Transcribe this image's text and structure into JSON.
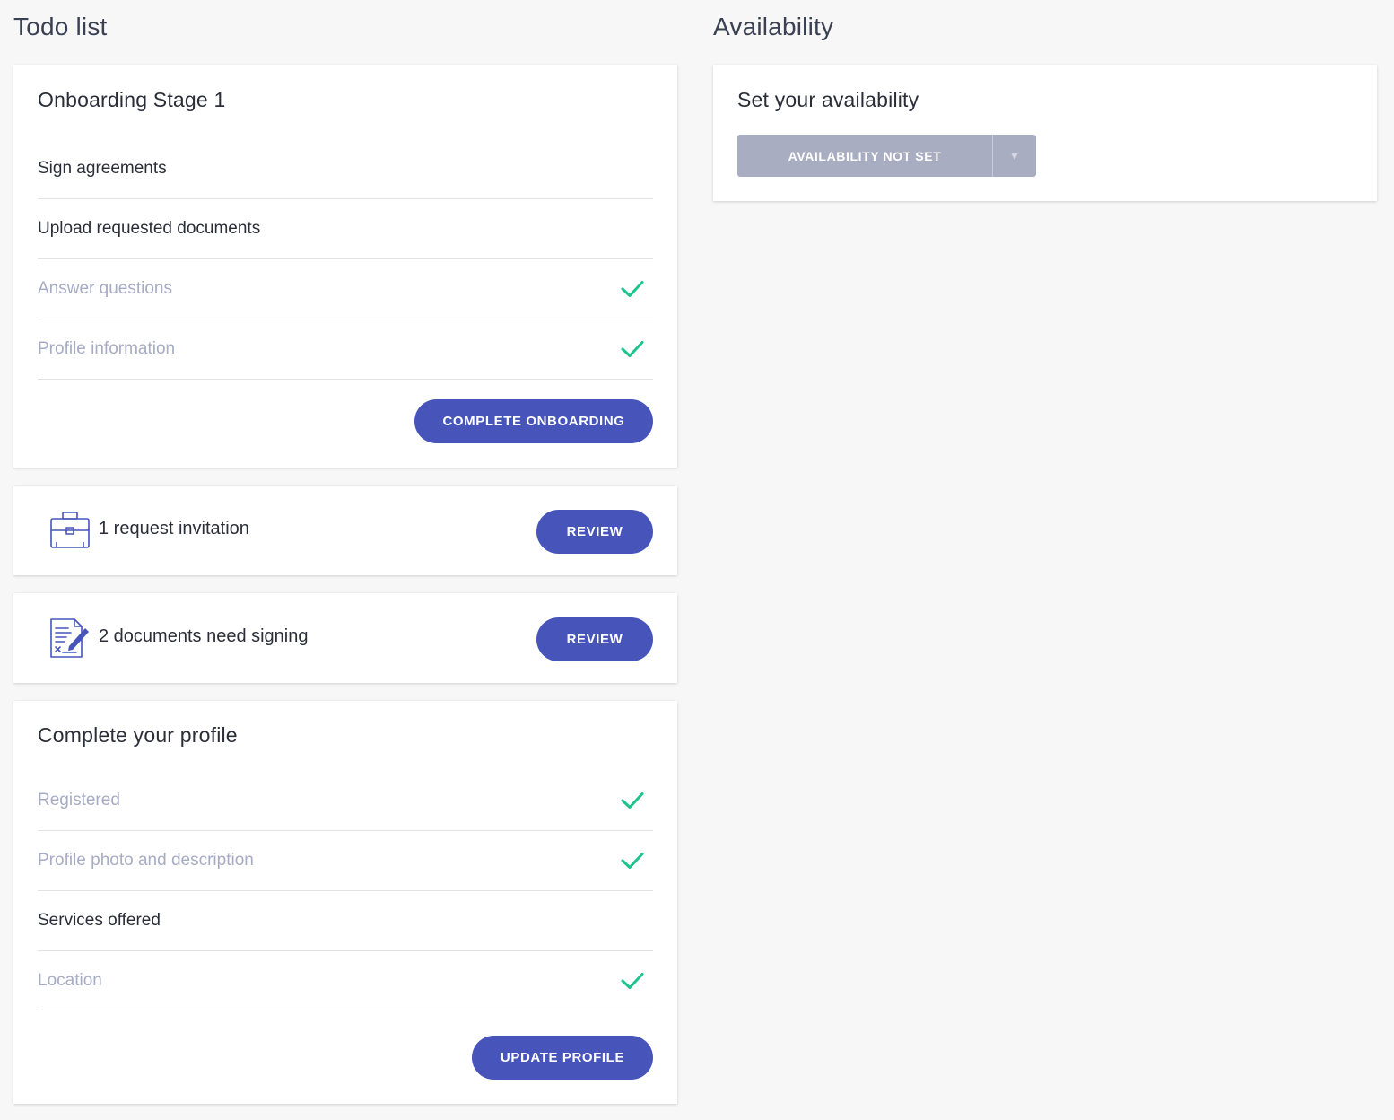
{
  "todo": {
    "title": "Todo list",
    "onboarding": {
      "title": "Onboarding Stage 1",
      "items": [
        {
          "label": "Sign agreements",
          "done": false
        },
        {
          "label": "Upload requested documents",
          "done": false
        },
        {
          "label": "Answer questions",
          "done": true
        },
        {
          "label": "Profile information",
          "done": true
        }
      ],
      "button_label": "COMPLETE ONBOARDING"
    },
    "invitation": {
      "text": "1 request invitation",
      "icon": "briefcase-icon",
      "button_label": "REVIEW"
    },
    "documents": {
      "text": "2 documents need signing",
      "icon": "document-sign-icon",
      "button_label": "REVIEW"
    },
    "profile": {
      "title": "Complete your profile",
      "items": [
        {
          "label": "Registered",
          "done": true
        },
        {
          "label": "Profile photo and description",
          "done": true
        },
        {
          "label": "Services offered",
          "done": false
        },
        {
          "label": "Location",
          "done": true
        }
      ],
      "button_label": "UPDATE PROFILE"
    }
  },
  "availability": {
    "title": "Availability",
    "card_title": "Set your availability",
    "selected": "AVAILABILITY NOT SET",
    "caret_glyph": "▼"
  },
  "colors": {
    "accent": "#4755bb",
    "check": "#1ec48b",
    "done_text": "#a6acc4",
    "availability_button": "#a9adc1"
  }
}
